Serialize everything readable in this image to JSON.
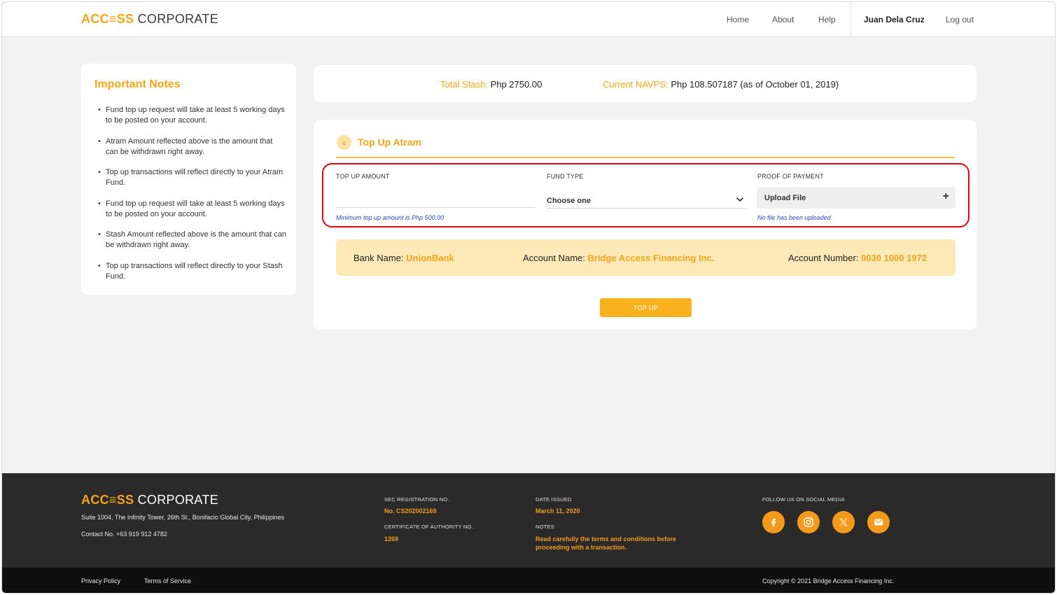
{
  "header": {
    "logo_part1": "ACC≡SS",
    "logo_part2": "CORPORATE",
    "nav": {
      "home": "Home",
      "about": "About",
      "help": "Help"
    },
    "user_name": "Juan Dela Cruz",
    "logout": "Log out"
  },
  "notes": {
    "title": "Important Notes",
    "items": [
      "Fund top up request will take at least 5 working days to be posted on your account.",
      "Atram Amount reflected above is the amount that can be withdrawn right away.",
      "Top up transactions will reflect directly to your Atram Fund.",
      "Fund top up request will take at least 5 working days to be posted on your account.",
      "Stash Amount reflected above is the amount that can be withdrawn right away.",
      "Top up transactions will reflect directly to your Stash Fund."
    ]
  },
  "stash": {
    "total_label": "Total Stash:",
    "total_value": "Php 2750.00",
    "navps_label": "Current NAVPS:",
    "navps_value": "Php 108.507187 (as of October 01, 2019)"
  },
  "form": {
    "title": "Top Up Atram",
    "amount_label": "TOP UP AMOUNT",
    "amount_value": "",
    "amount_hint": "Minimum top up amount is Php 500.00",
    "fund_label": "FUND TYPE",
    "fund_selected": "Choose one",
    "proof_label": "PROOF OF PAYMENT",
    "upload_label": "Upload File",
    "upload_hint": "No file has been uploaded",
    "submit_label": "TOP UP"
  },
  "bank": {
    "bank_label": "Bank Name:",
    "bank_value": "UnionBank",
    "account_name_label": "Account Name:",
    "account_name_value": "Bridge Access Financing Inc.",
    "account_number_label": "Account Number:",
    "account_number_value": "0030 1000 1972"
  },
  "footer": {
    "address": "Suite 1004, The Infinity Tower, 26th St., Bonifacio Global City, Philippines",
    "contact": "Contact No. +63 919 912 4782",
    "sec_label": "SEC REGISTRATION NO.",
    "sec_value": "No. CS202002169",
    "cert_label": "CERTIFICATE OF AUTHORITY NO.",
    "cert_value": "1269",
    "date_label": "DATE ISSUED",
    "date_value": "March 11, 2020",
    "notes_label": "NOTES",
    "notes_value": "Read carefully the terms and conditions before proceeding with a transaction.",
    "social_label": "FOLLOW US ON SOCIAL MEDIA",
    "social": [
      "facebook-icon",
      "instagram-icon",
      "x-twitter-icon",
      "email-icon"
    ],
    "privacy": "Privacy Policy",
    "terms": "Terms of Service",
    "copyright": "Copyright © 2021 Bridge Access Financing Inc."
  },
  "colors": {
    "accent": "#f5a515",
    "highlight_box": "#e3000f",
    "bank_bg": "#fde8b8",
    "footer_bg": "#2a2a2a",
    "bottom_bg": "#0f0f0f"
  }
}
